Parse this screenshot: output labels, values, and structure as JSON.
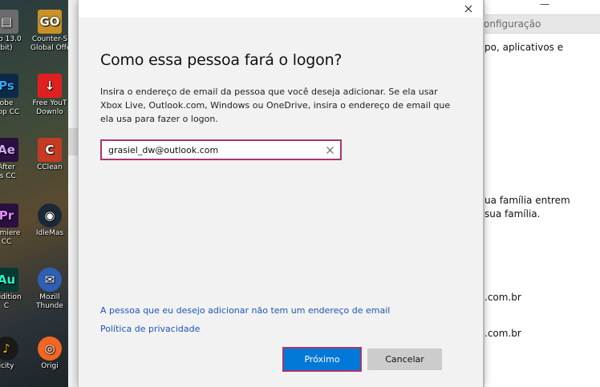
{
  "desktop": {
    "icons": [
      {
        "label1": "reo 13.0",
        "label2": "bit)",
        "icon": "burner-icon",
        "color": "#6b6b6b",
        "glyph": "▤"
      },
      {
        "label1": "Counter-S",
        "label2": "Global Offe",
        "icon": "counter-strike-icon",
        "color": "#c8912a",
        "glyph": "GO"
      },
      {
        "label1": "obe",
        "label2": "hop CC",
        "icon": "photoshop-icon",
        "color": "#0b2a4a",
        "glyph": "Ps"
      },
      {
        "label1": "Free YouT",
        "label2": "Downlo",
        "icon": "youtube-downloader-icon",
        "color": "#e02020",
        "glyph": "↓"
      },
      {
        "label1": "After",
        "label2": "ts CC",
        "icon": "after-effects-icon",
        "color": "#2a0f3f",
        "glyph": "Ae"
      },
      {
        "label1": "CClean",
        "label2": "",
        "icon": "ccleaner-icon",
        "color": "#c23b22",
        "glyph": "C"
      },
      {
        "label1": "remiere",
        "label2": "CC",
        "icon": "premiere-icon",
        "color": "#2a0f3f",
        "glyph": "Pr"
      },
      {
        "label1": "IdleMas",
        "label2": "",
        "icon": "idle-master-icon",
        "color": "#1b2838",
        "glyph": "◉"
      },
      {
        "label1": "Audition",
        "label2": "C",
        "icon": "audition-icon",
        "color": "#073a33",
        "glyph": "Au"
      },
      {
        "label1": "Mozill",
        "label2": "Thunde",
        "icon": "thunderbird-icon",
        "color": "#2f5fb3",
        "glyph": "✉"
      },
      {
        "label1": "icity",
        "label2": "",
        "icon": "audacity-icon",
        "color": "#1a1a1a",
        "glyph": "♪"
      },
      {
        "label1": "Origi",
        "label2": "",
        "icon": "origin-icon",
        "color": "#f26522",
        "glyph": "◎"
      }
    ]
  },
  "background_window": {
    "search_placeholder": "onfiguração",
    "minimize_glyph": "—",
    "texts": [
      "po, aplicativos e",
      "ua família entrem",
      "sua família.",
      ".com.br",
      ".com.br"
    ]
  },
  "dialog": {
    "title": "Como essa pessoa fará o logon?",
    "description": "Insira o endereço de email da pessoa que você deseja adicionar. Se ela usar Xbox Live, Outlook.com, Windows ou OneDrive, insira o endereço de email que ela usa para fazer o logon.",
    "email_value": "grasiel_dw@outlook.com",
    "no_email_link": "A pessoa que eu desejo adicionar não tem um endereço de email",
    "privacy_link": "Política de privacidade",
    "next_button": "Próximo",
    "cancel_button": "Cancelar",
    "accent_color": "#0078d7",
    "highlight_color": "#a8366d",
    "link_color": "#1d56b8"
  }
}
